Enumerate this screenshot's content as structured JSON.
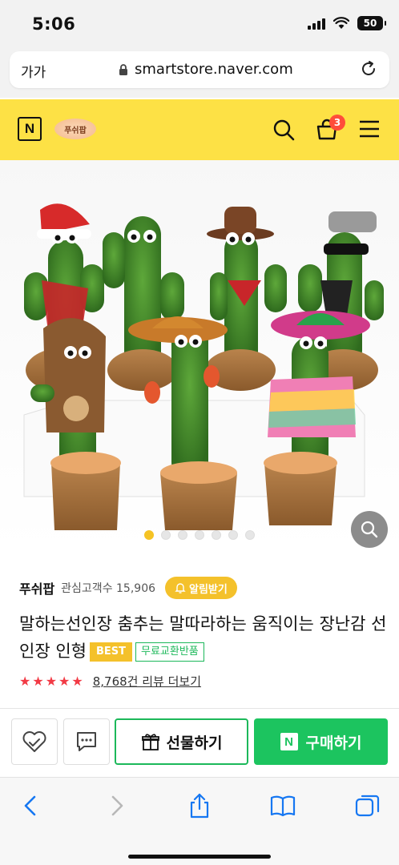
{
  "status": {
    "time": "5:06",
    "battery": "50"
  },
  "browser": {
    "text_size": "가가",
    "domain": "smartstore.naver.com"
  },
  "header": {
    "logo_letter": "N",
    "store_logo_text": "푸쉬팝",
    "cart_count": "3"
  },
  "gallery": {
    "total_slides": 7,
    "active_slide": 1
  },
  "store": {
    "name": "푸쉬팝",
    "followers_label": "관심고객수 15,906",
    "alarm_label": "알림받기"
  },
  "product": {
    "title": "말하는선인장 춤추는 말따라하는 움직이는 장난감 선인장 인형",
    "badge_best": "BEST",
    "badge_free": "무료교환반품",
    "rating_stars": 5,
    "reviews_label": "8,768건 리뷰 더보기"
  },
  "actions": {
    "gift_label": "선물하기",
    "buy_label": "구매하기",
    "buy_logo_letter": "N"
  },
  "colors": {
    "header": "#fde145",
    "accent": "#f4c12b",
    "green": "#1cc45f",
    "star": "#f23a45"
  }
}
